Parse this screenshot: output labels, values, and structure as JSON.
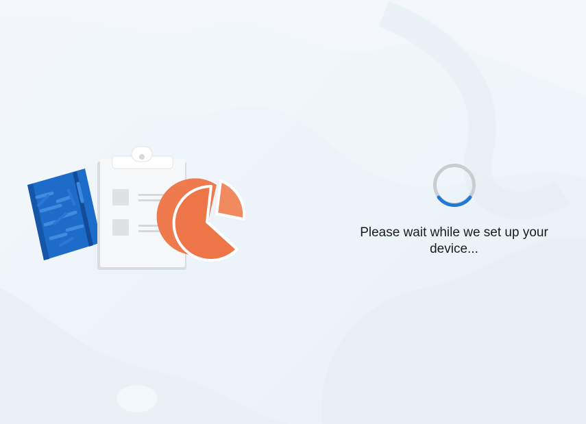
{
  "setup": {
    "status_message": "Please wait while we set up your device...",
    "progress_indicator": "indeterminate"
  },
  "illustration": {
    "items": [
      "notebook-icon",
      "clipboard-checklist-icon",
      "pie-chart-icon"
    ]
  },
  "colors": {
    "background": "#eef4f9",
    "spinner_track": "#c9ccd0",
    "spinner_accent": "#1f7ad6",
    "notebook": "#1f6fd0",
    "pie": "#f07a4f",
    "text": "#1b1b1b"
  }
}
